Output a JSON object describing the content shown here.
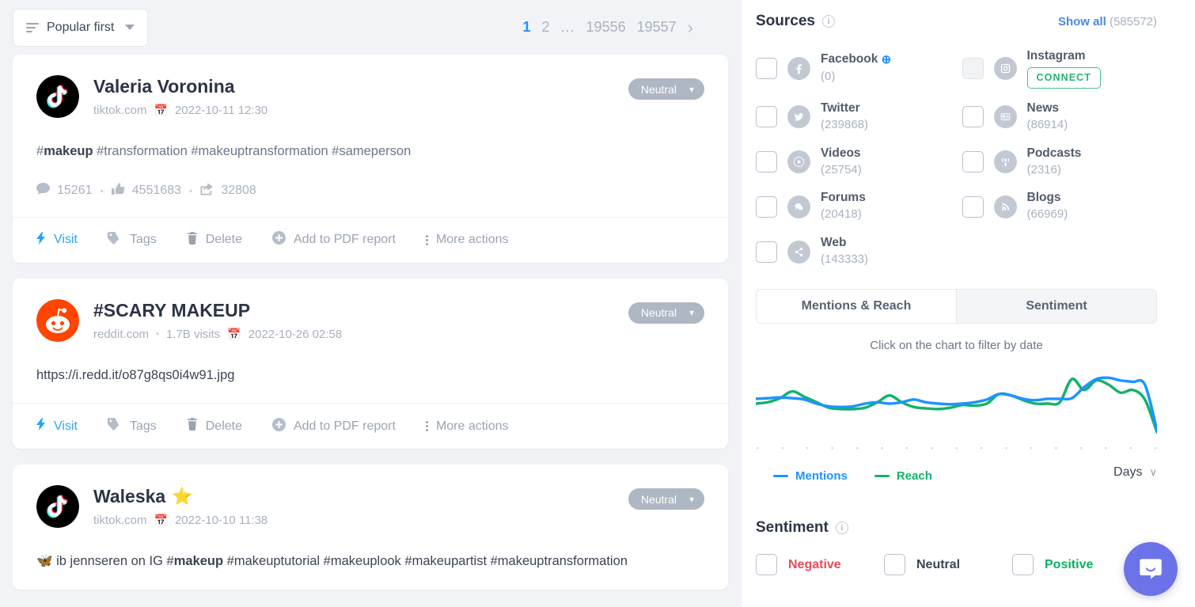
{
  "toolbar": {
    "sort_label": "Popular first",
    "pages": [
      {
        "label": "1",
        "active": true
      },
      {
        "label": "2",
        "active": false
      },
      {
        "label": "...",
        "active": false
      },
      {
        "label": "19556",
        "active": false
      },
      {
        "label": "19557",
        "active": false
      }
    ],
    "next_glyph": "›"
  },
  "actions": {
    "visit": "Visit",
    "tags": "Tags",
    "delete": "Delete",
    "add_pdf": "Add to PDF report",
    "more": "More actions"
  },
  "mentions": [
    {
      "avatar": "tiktok-logo",
      "author": "Valeria Voronina",
      "starred": false,
      "domain": "tiktok.com",
      "visits": "",
      "date": "2022-10-11 12:30",
      "sentiment": "Neutral",
      "text_prefix": "#",
      "text_bold": "makeup",
      "text_rest": " #transformation #makeuptransformation #sameperson",
      "stats": {
        "comments": "15261",
        "likes": "4551683",
        "shares": "32808"
      }
    },
    {
      "avatar": "reddit-logo",
      "author": "#SCARY MAKEUP",
      "starred": false,
      "domain": "reddit.com",
      "visits": "1.7B visits",
      "date": "2022-10-26 02:58",
      "sentiment": "Neutral",
      "text_plain": "https://i.redd.it/o87g8qs0i4w91.jpg"
    },
    {
      "avatar": "tiktok-logo",
      "author": "Waleska",
      "starred": true,
      "star_glyph": "⭐",
      "domain": "tiktok.com",
      "visits": "",
      "date": "2022-10-10 11:38",
      "sentiment": "Neutral",
      "text_prefix": "🦋 ib jennseren on IG #",
      "text_bold": "makeup",
      "text_rest": " #makeuptutorial #makeuplook #makeupartist #makeuptransformation"
    }
  ],
  "sources": {
    "title": "Sources",
    "show_all_label": "Show all",
    "show_all_count": "(585572)",
    "items": [
      {
        "name": "Facebook",
        "count": "(0)",
        "icon": "facebook-icon",
        "plus": true,
        "disabled": false
      },
      {
        "name": "Instagram",
        "count": "",
        "icon": "instagram-icon",
        "connect": "CONNECT",
        "disabled": true
      },
      {
        "name": "Twitter",
        "count": "(239868)",
        "icon": "twitter-icon",
        "disabled": false
      },
      {
        "name": "News",
        "count": "(86914)",
        "icon": "news-icon",
        "disabled": false
      },
      {
        "name": "Videos",
        "count": "(25754)",
        "icon": "video-icon",
        "disabled": false
      },
      {
        "name": "Podcasts",
        "count": "(2316)",
        "icon": "podcast-icon",
        "disabled": false
      },
      {
        "name": "Forums",
        "count": "(20418)",
        "icon": "forum-icon",
        "disabled": false
      },
      {
        "name": "Blogs",
        "count": "(66969)",
        "icon": "rss-icon",
        "disabled": false
      },
      {
        "name": "Web",
        "count": "(143333)",
        "icon": "share-icon",
        "disabled": false
      }
    ]
  },
  "chart_panel": {
    "tab_active": "Mentions & Reach",
    "tab_inactive": "Sentiment",
    "hint": "Click on the chart to filter by date",
    "legend_mentions": "Mentions",
    "legend_reach": "Reach",
    "granularity": "Days",
    "granularity_chevron": "∨"
  },
  "chart_data": {
    "type": "line",
    "title": "",
    "xlabel": "",
    "ylabel": "",
    "grid": false,
    "legend_position": "bottom-left",
    "x": [
      1,
      2,
      3,
      4,
      5,
      6,
      7,
      8,
      9,
      10,
      11,
      12,
      13,
      14,
      15,
      16,
      17,
      18,
      19,
      20,
      21,
      22,
      23,
      24,
      25,
      26,
      27,
      28,
      29,
      30,
      31,
      32,
      33,
      34
    ],
    "series": [
      {
        "name": "Mentions",
        "color": "#1f93ff",
        "values": [
          57,
          58,
          59,
          58,
          56,
          50,
          46,
          45,
          46,
          50,
          52,
          50,
          52,
          56,
          52,
          50,
          49,
          50,
          52,
          56,
          64,
          62,
          57,
          55,
          57,
          57,
          58,
          74,
          86,
          88,
          84,
          82,
          78,
          10
        ]
      },
      {
        "name": "Reach",
        "color": "#13b26b",
        "values": [
          50,
          52,
          58,
          68,
          60,
          52,
          44,
          42,
          42,
          44,
          52,
          62,
          52,
          45,
          43,
          42,
          44,
          48,
          47,
          50,
          64,
          62,
          55,
          50,
          50,
          52,
          86,
          70,
          84,
          78,
          66,
          70,
          56,
          8
        ]
      }
    ],
    "ylim": [
      0,
      100
    ],
    "tick_count": 17
  },
  "sentiment": {
    "title": "Sentiment",
    "options": [
      {
        "label": "Negative",
        "color": "#e94b5a"
      },
      {
        "label": "Neutral",
        "color": "#3c4454"
      },
      {
        "label": "Positive",
        "color": "#0cae63"
      }
    ]
  }
}
